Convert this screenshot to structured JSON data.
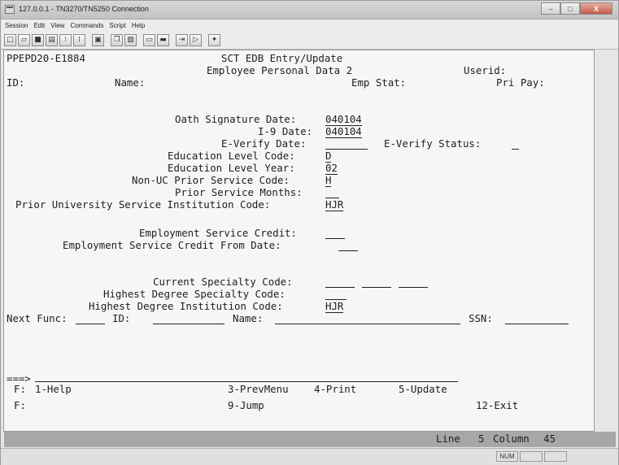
{
  "window": {
    "title": "127.0.0.1 - TN3270/TN5250 Connection",
    "buttons": [
      "–",
      "□",
      "X"
    ]
  },
  "menu": [
    "Session",
    "Edit",
    "View",
    "Commands",
    "Script",
    "Help"
  ],
  "toolbar_icons": [
    "new-session-icon",
    "open-icon",
    "save-icon",
    "print-setup-icon",
    "record-icon",
    "macro-icon",
    "print-screen-icon",
    "copy-icon",
    "paste-icon",
    "window-icon",
    "keyboard-icon",
    "connect-icon",
    "disconnect-icon",
    "settings-icon"
  ],
  "screen": {
    "program": "PPEPD20-E1884",
    "system_title": "SCT EDB Entry/Update",
    "screen_title": "Employee Personal Data 2",
    "userid_label": "Userid:",
    "id_label": "ID:",
    "name_label": "Name:",
    "emp_stat_label": "Emp Stat:",
    "pri_pay_label": "Pri Pay:",
    "fields": {
      "oath_label": "Oath Signature Date:",
      "oath_value": "040104",
      "i9_label": "I-9 Date:",
      "i9_value": "040104",
      "everify_label": "E-Verify Date:",
      "everify_status_label": "E-Verify Status:",
      "edu_code_label": "Education Level Code:",
      "edu_code_value": "D",
      "edu_year_label": "Education Level Year:",
      "edu_year_value": "02",
      "nonuc_label": "Non-UC Prior Service Code:",
      "nonuc_value": "H",
      "prior_months_label": "Prior Service Months:",
      "prior_inst_label": "Prior University Service Institution Code:",
      "prior_inst_value": "HJR",
      "emp_credit_label": "Employment Service Credit:",
      "emp_credit_from_label": "Employment Service Credit From Date:",
      "cur_spec_label": "Current Specialty Code:",
      "high_spec_label": "Highest Degree Specialty Code:",
      "high_inst_label": "Highest Degree Institution Code:",
      "high_inst_value": "HJR"
    },
    "next_func_label": "Next Func:",
    "nf_id_label": "ID:",
    "nf_name_label": "Name:",
    "ssn_label": "SSN:",
    "command_prompt": "===>",
    "fkeys_row1": {
      "prefix": "F:",
      "help": "1-Help",
      "prev": "3-PrevMenu",
      "print": "4-Print",
      "update": "5-Update"
    },
    "fkeys_row2": {
      "prefix": "F:",
      "jump": "9-Jump",
      "exit": "12-Exit"
    }
  },
  "status_line": {
    "line_label": "Line",
    "line": "5",
    "column_label": "Column",
    "column": "45"
  },
  "statusbar": {
    "num": "NUM"
  }
}
